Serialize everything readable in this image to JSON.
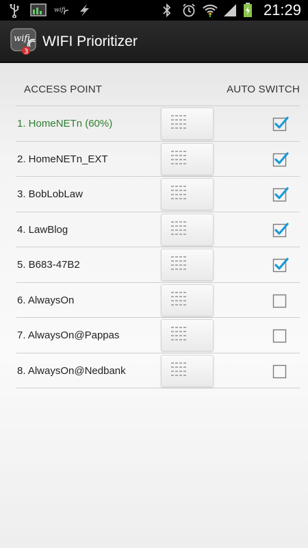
{
  "status_bar": {
    "time": "21:29",
    "icons": [
      "usb-icon",
      "monitor-icon",
      "wifi-label-icon",
      "charging-flash-icon",
      "bluetooth-icon",
      "alarm-icon",
      "wifi-signal-icon",
      "cell-signal-icon",
      "battery-charging-icon"
    ]
  },
  "action_bar": {
    "title": "WIFI Prioritizer",
    "app_icon": "wifi-app-icon"
  },
  "table": {
    "col_access_point": "ACCESS POINT",
    "col_auto_switch": "AUTO SWITCH",
    "rows": [
      {
        "label": "1. HomeNETn (60%)",
        "checked": true,
        "active": true
      },
      {
        "label": "2. HomeNETn_EXT",
        "checked": true,
        "active": false
      },
      {
        "label": "3. BobLobLaw",
        "checked": true,
        "active": false
      },
      {
        "label": "4. LawBlog",
        "checked": true,
        "active": false
      },
      {
        "label": "5. B683-47B2",
        "checked": true,
        "active": false
      },
      {
        "label": "6. AlwaysOn",
        "checked": false,
        "active": false
      },
      {
        "label": "7. AlwaysOn@Pappas",
        "checked": false,
        "active": false
      },
      {
        "label": "8. AlwaysOn@Nedbank",
        "checked": false,
        "active": false
      }
    ]
  },
  "colors": {
    "active_text": "#2e7d2e",
    "check_blue": "#1a9ad6"
  }
}
